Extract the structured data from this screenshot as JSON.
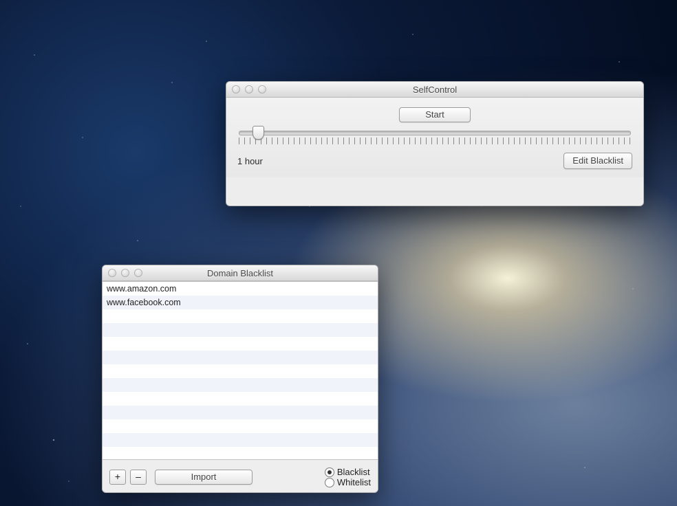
{
  "selfcontrol": {
    "title": "SelfControl",
    "start_button": "Start",
    "duration_label": "1 hour",
    "edit_blacklist_button": "Edit Blacklist",
    "slider_value_hours": 1
  },
  "blacklist": {
    "title": "Domain Blacklist",
    "domains": [
      "www.amazon.com",
      "www.facebook.com"
    ],
    "visible_row_count": 13,
    "add_button": "+",
    "remove_button": "–",
    "import_button": "Import",
    "mode_options": {
      "blacklist_label": "Blacklist",
      "whitelist_label": "Whitelist",
      "selected": "blacklist"
    }
  }
}
